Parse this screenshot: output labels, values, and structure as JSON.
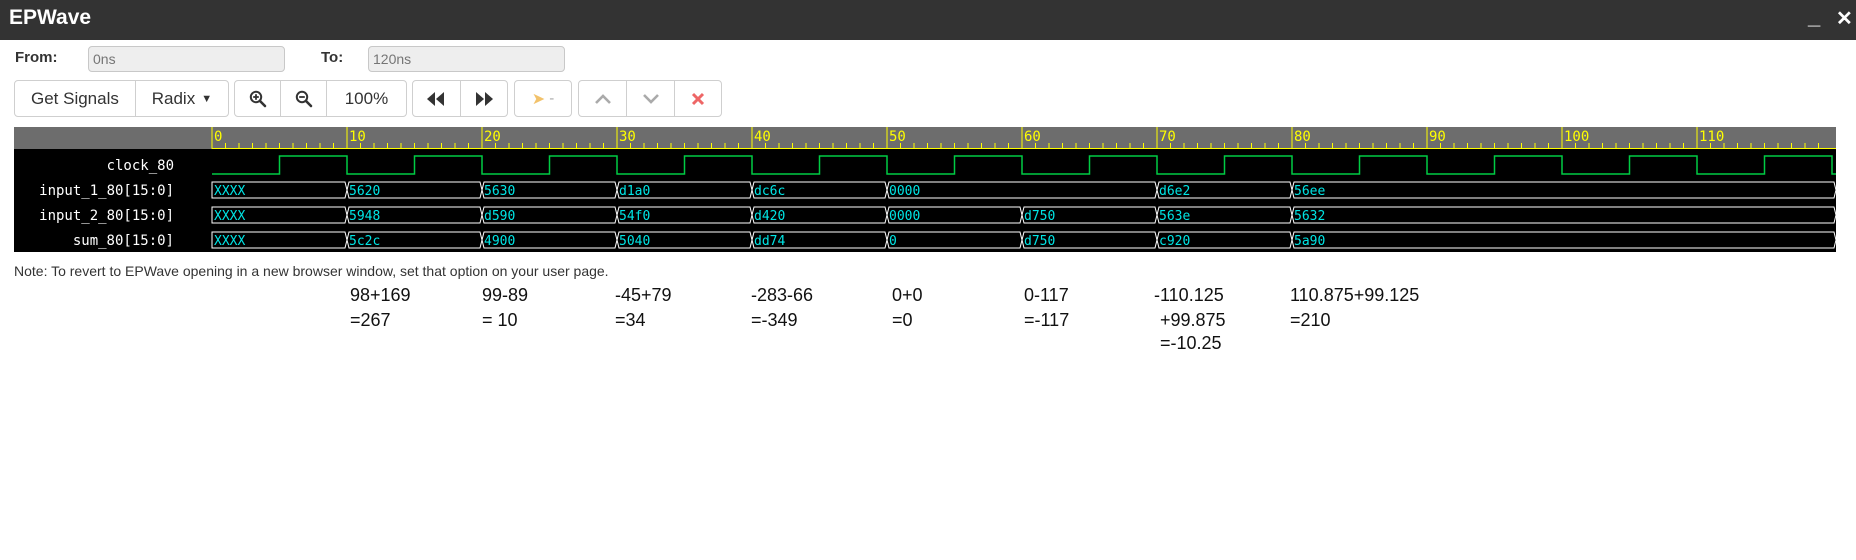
{
  "app": {
    "title": "EPWave",
    "minimize_icon": "minimize-icon",
    "close_icon": "close-icon"
  },
  "range": {
    "from_label": "From:",
    "from_placeholder": "0ns",
    "to_label": "To:",
    "to_placeholder": "120ns"
  },
  "toolbar": {
    "get_signals": "Get Signals",
    "radix": "Radix",
    "zoom_level": "100%",
    "marker_label": "-",
    "icons": [
      "zoom-in-icon",
      "zoom-out-icon",
      "rewind-icon",
      "fast-forward-icon",
      "marker-icon",
      "chevron-up-icon",
      "chevron-down-icon",
      "delete-icon"
    ]
  },
  "waveform": {
    "timescale": "ns",
    "time_range": [
      0,
      120
    ],
    "tick_labels": [
      "0",
      "10",
      "20",
      "30",
      "40",
      "50",
      "60",
      "70",
      "80",
      "90",
      "100",
      "110"
    ],
    "colors": {
      "ruler": "#6d6d6d",
      "tick": "#ffff00",
      "clock": "#00cc44",
      "bus": "#ffffff",
      "value_text": "#00e5e5",
      "background": "#000000",
      "names_text": "#ffffff"
    },
    "clock": {
      "name": "clock_80",
      "period": 10,
      "first_rise": 5
    },
    "buses": [
      {
        "name": "input_1_80[15:0]",
        "segments": [
          {
            "start": 0,
            "value": "XXXX"
          },
          {
            "start": 10,
            "value": "5620"
          },
          {
            "start": 20,
            "value": "5630"
          },
          {
            "start": 30,
            "value": "d1a0"
          },
          {
            "start": 40,
            "value": "dc6c"
          },
          {
            "start": 50,
            "value": "0000"
          },
          {
            "start": 70,
            "value": "d6e2"
          },
          {
            "start": 80,
            "value": "56ee"
          }
        ]
      },
      {
        "name": "input_2_80[15:0]",
        "segments": [
          {
            "start": 0,
            "value": "XXXX"
          },
          {
            "start": 10,
            "value": "5948"
          },
          {
            "start": 20,
            "value": "d590"
          },
          {
            "start": 30,
            "value": "54f0"
          },
          {
            "start": 40,
            "value": "d420"
          },
          {
            "start": 50,
            "value": "0000"
          },
          {
            "start": 60,
            "value": "d750"
          },
          {
            "start": 70,
            "value": "563e"
          },
          {
            "start": 80,
            "value": "5632"
          }
        ]
      },
      {
        "name": "sum_80[15:0]",
        "segments": [
          {
            "start": 0,
            "value": "XXXX"
          },
          {
            "start": 10,
            "value": "5c2c"
          },
          {
            "start": 20,
            "value": "4900"
          },
          {
            "start": 30,
            "value": "5040"
          },
          {
            "start": 40,
            "value": "dd74"
          },
          {
            "start": 50,
            "value": "0"
          },
          {
            "start": 60,
            "value": "d750"
          },
          {
            "start": 70,
            "value": "c920"
          },
          {
            "start": 80,
            "value": "5a90"
          }
        ]
      }
    ]
  },
  "note": "Note: To revert to EPWave opening in a new browser window, set that option on your user page.",
  "annotations": [
    {
      "lines": [
        "98+169",
        "=267"
      ]
    },
    {
      "lines": [
        "99-89",
        "= 10"
      ]
    },
    {
      "lines": [
        "-45+79",
        "=34"
      ]
    },
    {
      "lines": [
        "-283-66",
        "=-349"
      ]
    },
    {
      "lines": [
        "0+0",
        "=0"
      ]
    },
    {
      "lines": [
        "0-117",
        "=-117"
      ]
    },
    {
      "lines": [
        "-110.125",
        "+99.875",
        "=-10.25"
      ]
    },
    {
      "lines": [
        "110.875+99.125",
        "=210"
      ]
    }
  ]
}
